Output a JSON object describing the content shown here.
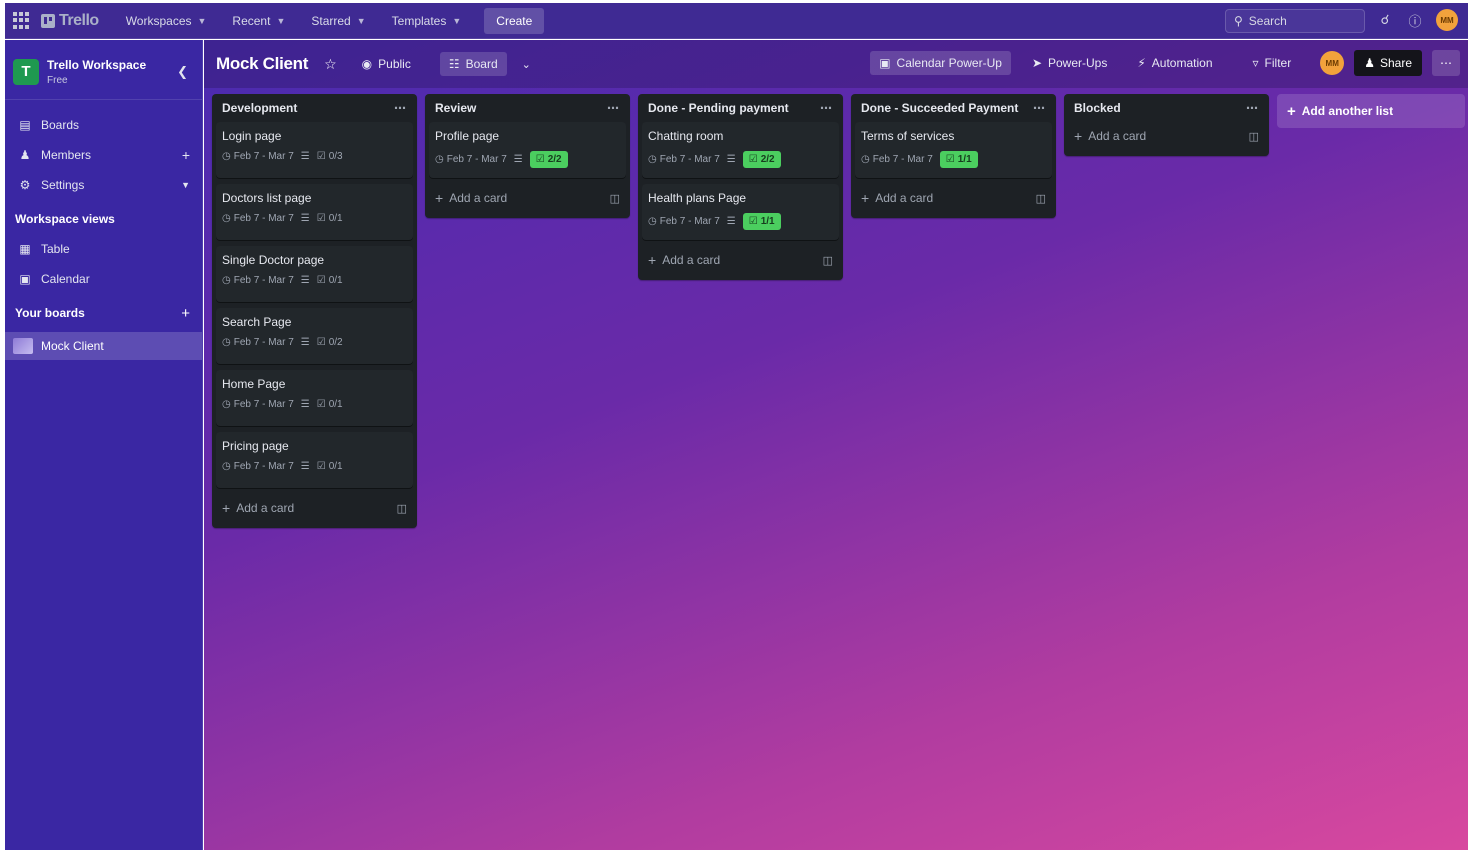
{
  "topnav": {
    "logo": "Trello",
    "menus": [
      {
        "label": "Workspaces"
      },
      {
        "label": "Recent"
      },
      {
        "label": "Starred"
      },
      {
        "label": "Templates"
      }
    ],
    "create_label": "Create",
    "search_placeholder": "Search",
    "avatar_initials": "MM"
  },
  "sidebar": {
    "workspace_initial": "T",
    "workspace_name": "Trello Workspace",
    "workspace_plan": "Free",
    "items": [
      {
        "label": "Boards"
      },
      {
        "label": "Members"
      },
      {
        "label": "Settings"
      }
    ],
    "views_heading": "Workspace views",
    "views": [
      {
        "label": "Table"
      },
      {
        "label": "Calendar"
      }
    ],
    "boards_heading": "Your boards",
    "boards": [
      {
        "label": "Mock Client"
      }
    ]
  },
  "board": {
    "title": "Mock Client",
    "visibility": "Public",
    "view": "Board",
    "calendar_powerup": "Calendar Power-Up",
    "powerups": "Power-Ups",
    "automation": "Automation",
    "filter": "Filter",
    "avatar_initials": "MM",
    "share": "Share",
    "add_list": "Add another list",
    "add_card": "Add a card",
    "lists": [
      {
        "name": "Development",
        "cards": [
          {
            "title": "Login page",
            "dates": "Feb 7 - Mar 7",
            "checklist": "0/3",
            "complete": false
          },
          {
            "title": "Doctors list page",
            "dates": "Feb 7 - Mar 7",
            "checklist": "0/1",
            "complete": false
          },
          {
            "title": "Single Doctor page",
            "dates": "Feb 7 - Mar 7",
            "checklist": "0/1",
            "complete": false
          },
          {
            "title": "Search Page",
            "dates": "Feb 7 - Mar 7",
            "checklist": "0/2",
            "complete": false
          },
          {
            "title": "Home Page",
            "dates": "Feb 7 - Mar 7",
            "checklist": "0/1",
            "complete": false
          },
          {
            "title": "Pricing page",
            "dates": "Feb 7 - Mar 7",
            "checklist": "0/1",
            "complete": false
          }
        ]
      },
      {
        "name": "Review",
        "cards": [
          {
            "title": "Profile page",
            "dates": "Feb 7 - Mar 7",
            "checklist": "2/2",
            "complete": true
          }
        ]
      },
      {
        "name": "Done - Pending payment",
        "cards": [
          {
            "title": "Chatting room",
            "dates": "Feb 7 - Mar 7",
            "checklist": "2/2",
            "complete": true
          },
          {
            "title": "Health plans Page",
            "dates": "Feb 7 - Mar 7",
            "checklist": "1/1",
            "complete": true
          }
        ]
      },
      {
        "name": "Done - Succeeded Payment",
        "cards": [
          {
            "title": "Terms of services",
            "dates": "Feb 7 - Mar 7",
            "checklist": "1/1",
            "complete": true
          }
        ]
      },
      {
        "name": "Blocked",
        "cards": []
      }
    ]
  }
}
